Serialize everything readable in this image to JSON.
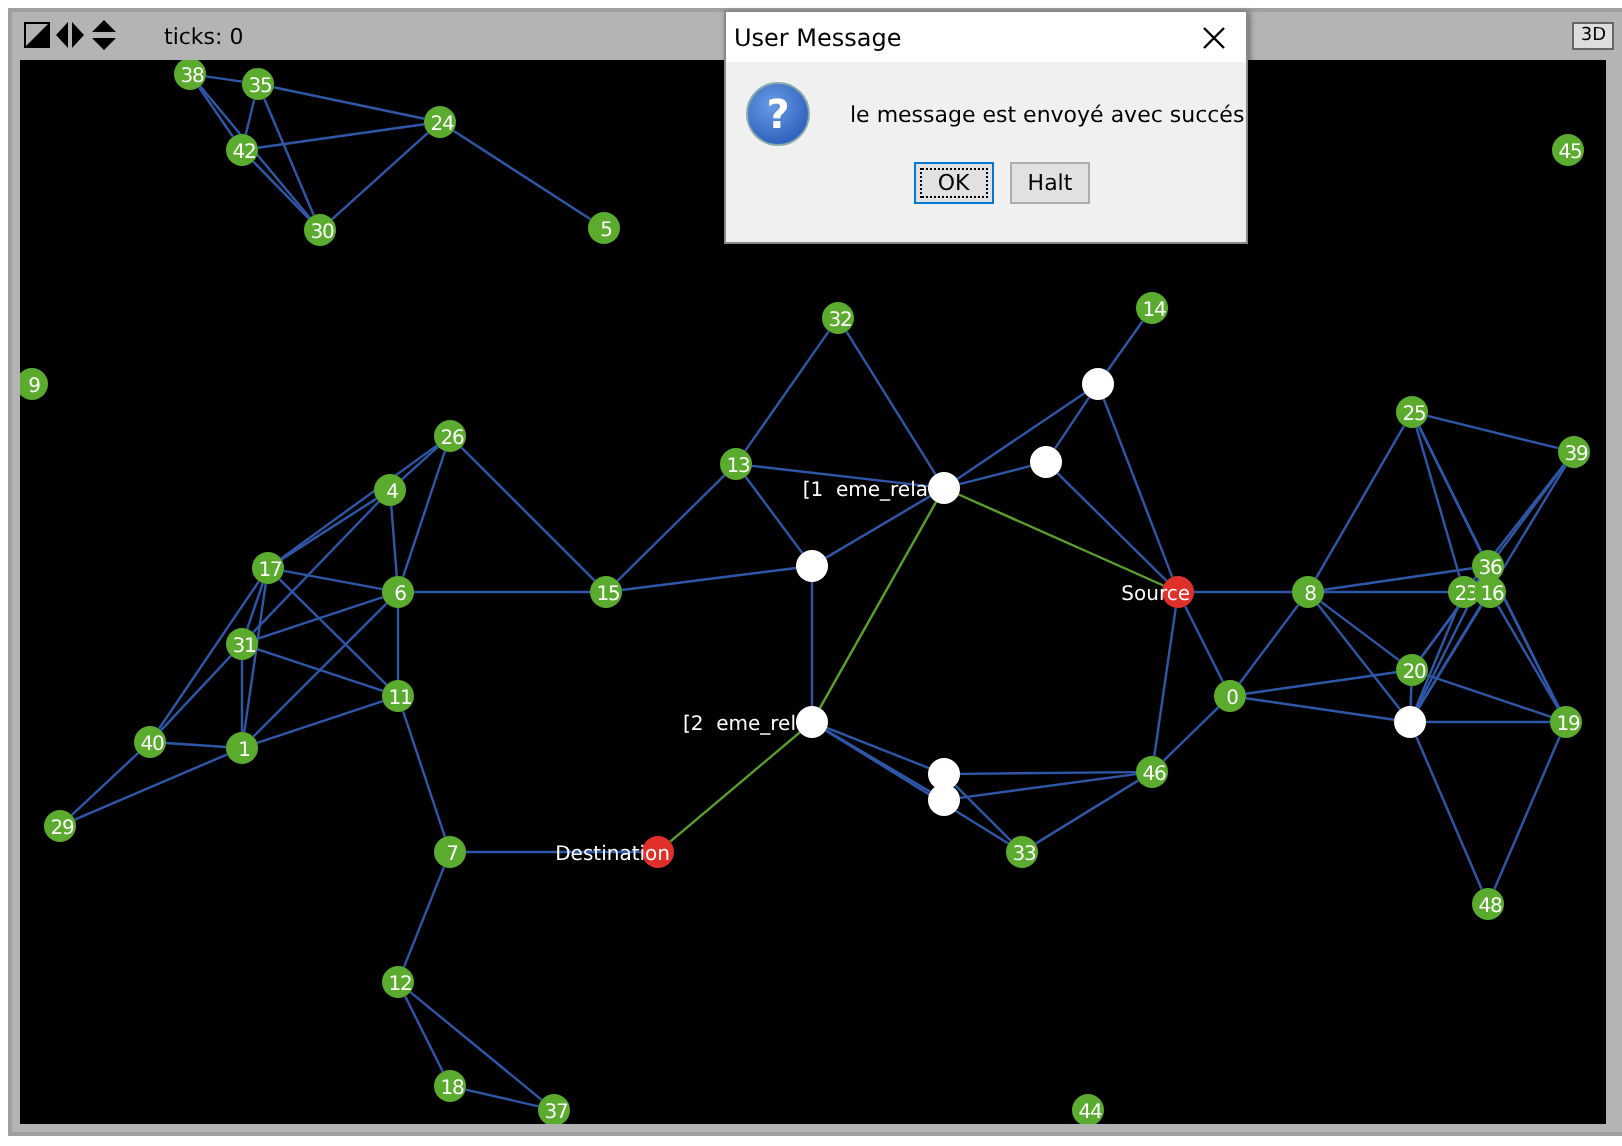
{
  "toolbar": {
    "ticks": "ticks: 0",
    "view_button": "3D"
  },
  "world": {
    "nodes": [
      {
        "kind": "number",
        "label": "38",
        "color": "#5aab2e"
      },
      {
        "kind": "number",
        "label": "35",
        "color": "#5aab2e"
      },
      {
        "kind": "number",
        "label": "42",
        "color": "#5aab2e"
      },
      {
        "kind": "number",
        "label": "24",
        "color": "#5aab2e"
      },
      {
        "kind": "number",
        "label": "30",
        "color": "#5aab2e"
      },
      {
        "kind": "number",
        "label": "5",
        "color": "#5aab2e"
      },
      {
        "kind": "number",
        "label": "45",
        "color": "#5aab2e"
      },
      {
        "kind": "number",
        "label": "9",
        "color": "#5aab2e"
      },
      {
        "kind": "number",
        "label": "32",
        "color": "#5aab2e"
      },
      {
        "kind": "number",
        "label": "14",
        "color": "#5aab2e"
      },
      {
        "kind": "plain",
        "color": "#ffffff"
      },
      {
        "kind": "number",
        "label": "26",
        "color": "#5aab2e"
      },
      {
        "kind": "number",
        "label": "4",
        "color": "#5aab2e"
      },
      {
        "kind": "number",
        "label": "25",
        "color": "#5aab2e"
      },
      {
        "kind": "number",
        "label": "39",
        "color": "#5aab2e"
      },
      {
        "kind": "number",
        "label": "13",
        "color": "#5aab2e"
      },
      {
        "kind": "tag",
        "label": "[1  eme_rela",
        "color": "#ffffff"
      },
      {
        "kind": "plain",
        "color": "#ffffff"
      },
      {
        "kind": "number",
        "label": "17",
        "color": "#5aab2e"
      },
      {
        "kind": "number",
        "label": "6",
        "color": "#5aab2e"
      },
      {
        "kind": "number",
        "label": "15",
        "color": "#5aab2e"
      },
      {
        "kind": "plain",
        "color": "#ffffff"
      },
      {
        "kind": "tag",
        "label": "Source",
        "color": "#e0302a"
      },
      {
        "kind": "number",
        "label": "8",
        "color": "#5aab2e"
      },
      {
        "kind": "number",
        "label": "36",
        "color": "#5aab2e"
      },
      {
        "kind": "number",
        "label": "23",
        "color": "#5aab2e"
      },
      {
        "kind": "number",
        "label": "16",
        "color": "#5aab2e"
      },
      {
        "kind": "number",
        "label": "31",
        "color": "#5aab2e"
      },
      {
        "kind": "number",
        "label": "11",
        "color": "#5aab2e"
      },
      {
        "kind": "number",
        "label": "0",
        "color": "#5aab2e"
      },
      {
        "kind": "number",
        "label": "20",
        "color": "#5aab2e"
      },
      {
        "kind": "plain",
        "color": "#ffffff"
      },
      {
        "kind": "number",
        "label": "19",
        "color": "#5aab2e"
      },
      {
        "kind": "tag",
        "label": "[2  eme_rel",
        "color": "#ffffff"
      },
      {
        "kind": "number",
        "label": "40",
        "color": "#5aab2e"
      },
      {
        "kind": "number",
        "label": "1",
        "color": "#5aab2e"
      },
      {
        "kind": "plain",
        "color": "#ffffff"
      },
      {
        "kind": "plain",
        "color": "#ffffff"
      },
      {
        "kind": "number",
        "label": "46",
        "color": "#5aab2e"
      },
      {
        "kind": "number",
        "label": "29",
        "color": "#5aab2e"
      },
      {
        "kind": "number",
        "label": "7",
        "color": "#5aab2e"
      },
      {
        "kind": "tag",
        "label": "Destination",
        "color": "#e0302a"
      },
      {
        "kind": "number",
        "label": "33",
        "color": "#5aab2e"
      },
      {
        "kind": "number",
        "label": "48",
        "color": "#5aab2e"
      },
      {
        "kind": "number",
        "label": "12",
        "color": "#5aab2e"
      },
      {
        "kind": "number",
        "label": "18",
        "color": "#5aab2e"
      },
      {
        "kind": "number",
        "label": "37",
        "color": "#5aab2e"
      },
      {
        "kind": "number",
        "label": "44",
        "color": "#5aab2e"
      }
    ]
  },
  "dialog": {
    "title": "User Message",
    "icon": "?",
    "message": "le message est envoyé avec succés",
    "buttons": [
      {
        "label": "OK",
        "selected": true
      },
      {
        "label": "Halt",
        "selected": false
      }
    ]
  }
}
